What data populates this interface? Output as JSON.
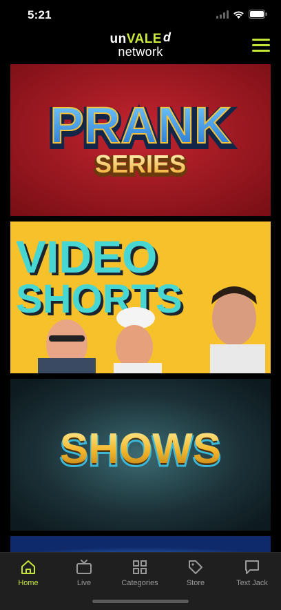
{
  "status_bar": {
    "time": "5:21"
  },
  "header": {
    "logo_prefix": "un",
    "logo_highlight": "VALE",
    "logo_suffix": "d",
    "logo_line2": "network"
  },
  "feed": {
    "tiles": [
      {
        "line1": "PRANK",
        "line2": "SERIES"
      },
      {
        "line1": "VIDEO",
        "line2": "SHORTS"
      },
      {
        "line1": "SHOWS"
      }
    ]
  },
  "tab_bar": {
    "items": [
      {
        "label": "Home",
        "icon": "home-icon",
        "active": true
      },
      {
        "label": "Live",
        "icon": "tv-icon",
        "active": false
      },
      {
        "label": "Categories",
        "icon": "grid-icon",
        "active": false
      },
      {
        "label": "Store",
        "icon": "tag-icon",
        "active": false
      },
      {
        "label": "Text Jack",
        "icon": "chat-icon",
        "active": false
      }
    ]
  },
  "colors": {
    "accent": "#c4e53a",
    "background": "#000000",
    "tab_bar": "#1f1f1f"
  }
}
